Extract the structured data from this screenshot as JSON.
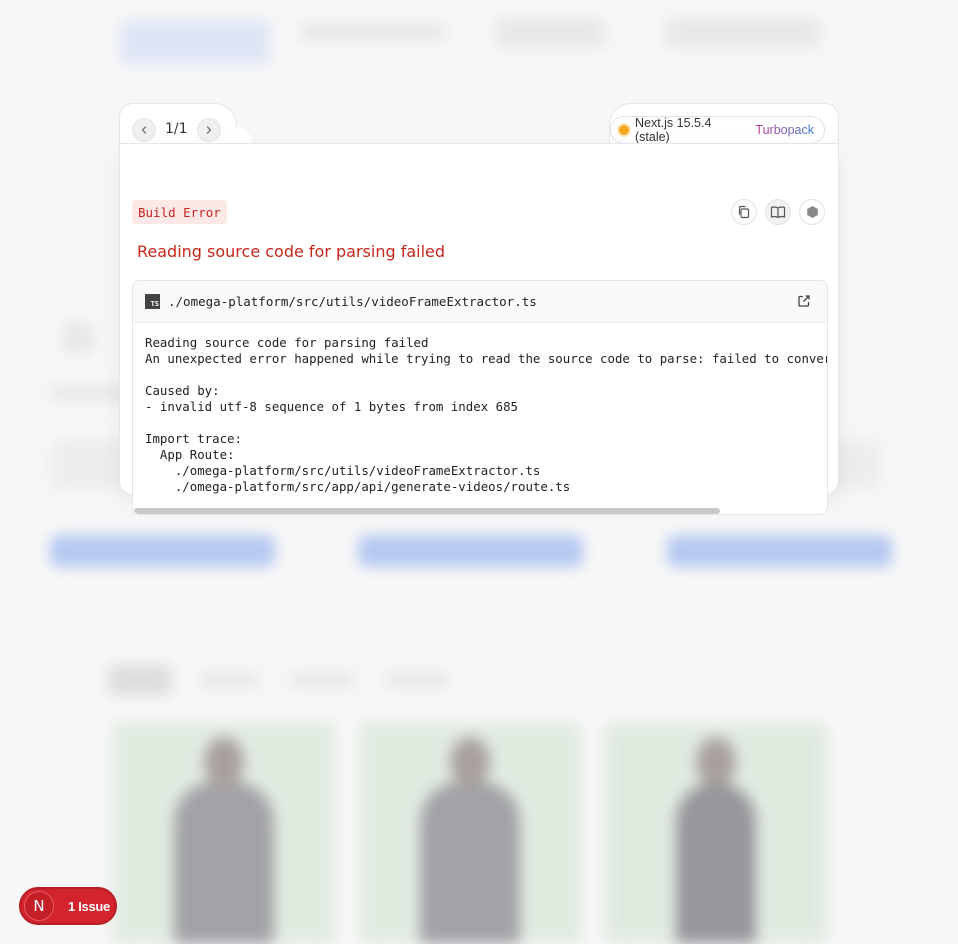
{
  "navigation": {
    "prev_icon": "chevron-left-icon",
    "next_icon": "chevron-right-icon",
    "count": "1/1"
  },
  "version": {
    "text": "Next.js 15.5.4 (stale)",
    "bundler": "Turbopack",
    "status_color": "#f5a623"
  },
  "error": {
    "badge": "Build Error",
    "title": "Reading source code for parsing failed",
    "accent_color": "#c8261d"
  },
  "actions": {
    "copy_icon": "copy-icon",
    "docs_icon": "book-icon",
    "nodejs_icon": "hexagon-icon"
  },
  "code_frame": {
    "file_path": "./omega-platform/src/utils/videoFrameExtractor.ts",
    "file_icon": "ts-icon",
    "open_icon": "external-link-icon",
    "content": "Reading source code for parsing failed\nAn unexpected error happened while trying to read the source code to parse: failed to convert r\n\nCaused by:\n- invalid utf-8 sequence of 1 bytes from index 685\n\nImport trace:\n  App Route:\n    ./omega-platform/src/utils/videoFrameExtractor.ts\n    ./omega-platform/src/app/api/generate-videos/route.ts"
  },
  "issues": {
    "logo_letter": "N",
    "label": "1 Issue",
    "color": "#d3232c"
  }
}
